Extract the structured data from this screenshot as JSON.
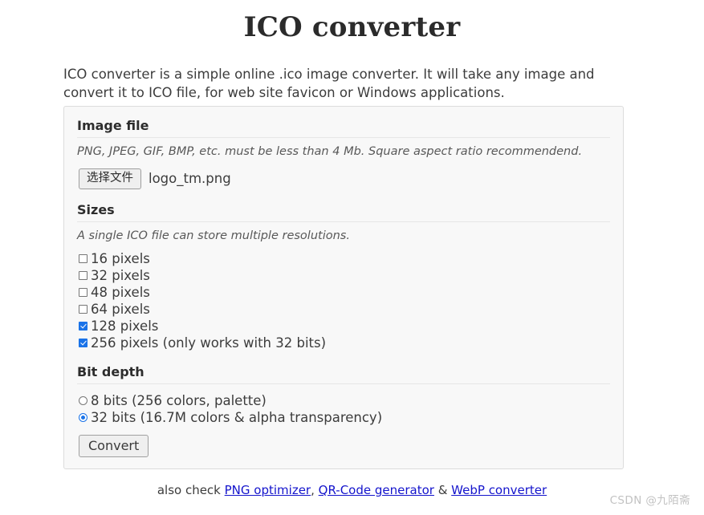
{
  "page": {
    "title": "ICO converter",
    "intro": "ICO converter is a simple online .ico image converter. It will take any image and convert it to ICO file, for web site favicon or Windows applications."
  },
  "form": {
    "image_file": {
      "heading": "Image file",
      "hint": "PNG, JPEG, GIF, BMP, etc. must be less than 4 Mb. Square aspect ratio recommendend.",
      "choose_button": "选择文件",
      "file_name": "logo_tm.png"
    },
    "sizes": {
      "heading": "Sizes",
      "hint": "A single ICO file can store multiple resolutions.",
      "options": [
        {
          "label": "16 pixels",
          "checked": false
        },
        {
          "label": "32 pixels",
          "checked": false
        },
        {
          "label": "48 pixels",
          "checked": false
        },
        {
          "label": "64 pixels",
          "checked": false
        },
        {
          "label": "128 pixels",
          "checked": true
        },
        {
          "label": "256 pixels (only works with 32 bits)",
          "checked": true
        }
      ]
    },
    "bit_depth": {
      "heading": "Bit depth",
      "options": [
        {
          "label": "8 bits (256 colors, palette)",
          "selected": false
        },
        {
          "label": "32 bits (16.7M colors & alpha transparency)",
          "selected": true
        }
      ]
    },
    "submit_label": "Convert"
  },
  "footer": {
    "prefix": "also check ",
    "link1": "PNG optimizer",
    "sep1": ", ",
    "link2": "QR-Code generator",
    "sep2": " & ",
    "link3": "WebP converter"
  },
  "watermark": "CSDN @九陌斋",
  "colors": {
    "accent": "#1a73e8",
    "link": "#1414cc",
    "panel_bg": "#f8f8f8",
    "panel_border": "#dcdcdc"
  }
}
